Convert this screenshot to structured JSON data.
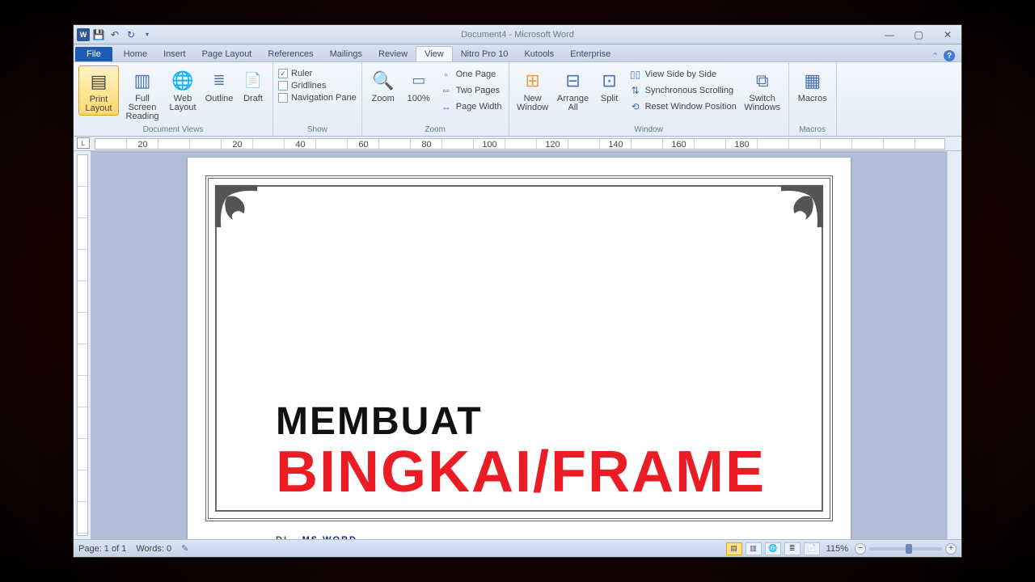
{
  "titlebar": {
    "title": "Document4 - Microsoft Word"
  },
  "tabs": {
    "file": "File",
    "items": [
      "Home",
      "Insert",
      "Page Layout",
      "References",
      "Mailings",
      "Review",
      "View",
      "Nitro Pro 10",
      "Kutools",
      "Enterprise"
    ],
    "active": "View"
  },
  "ribbon": {
    "docviews": {
      "label": "Document Views",
      "print_layout": "Print Layout",
      "full_screen": "Full Screen Reading",
      "web_layout": "Web Layout",
      "outline": "Outline",
      "draft": "Draft"
    },
    "show": {
      "label": "Show",
      "ruler": "Ruler",
      "gridlines": "Gridlines",
      "nav": "Navigation Pane"
    },
    "zoom": {
      "label": "Zoom",
      "zoom": "Zoom",
      "p100": "100%",
      "one": "One Page",
      "two": "Two Pages",
      "width": "Page Width"
    },
    "window": {
      "label": "Window",
      "new": "New Window",
      "arrange": "Arrange All",
      "split": "Split",
      "sbs": "View Side by Side",
      "sync": "Synchronous Scrolling",
      "reset": "Reset Window Position",
      "switch": "Switch Windows"
    },
    "macros": {
      "label": "Macros",
      "macros": "Macros"
    }
  },
  "ruler": {
    "nums": [
      "",
      "20",
      "",
      "",
      "20",
      "",
      "40",
      "",
      "60",
      "",
      "80",
      "",
      "100",
      "",
      "120",
      "",
      "140",
      "",
      "160",
      "",
      "180"
    ]
  },
  "overlay": {
    "line1": "MEMBUAT",
    "line2": "BINGKAI/FRAME",
    "line3a": "DI",
    "line3b": "MS WORD"
  },
  "status": {
    "page": "Page: 1 of 1",
    "words": "Words: 0",
    "zoom": "115%"
  }
}
